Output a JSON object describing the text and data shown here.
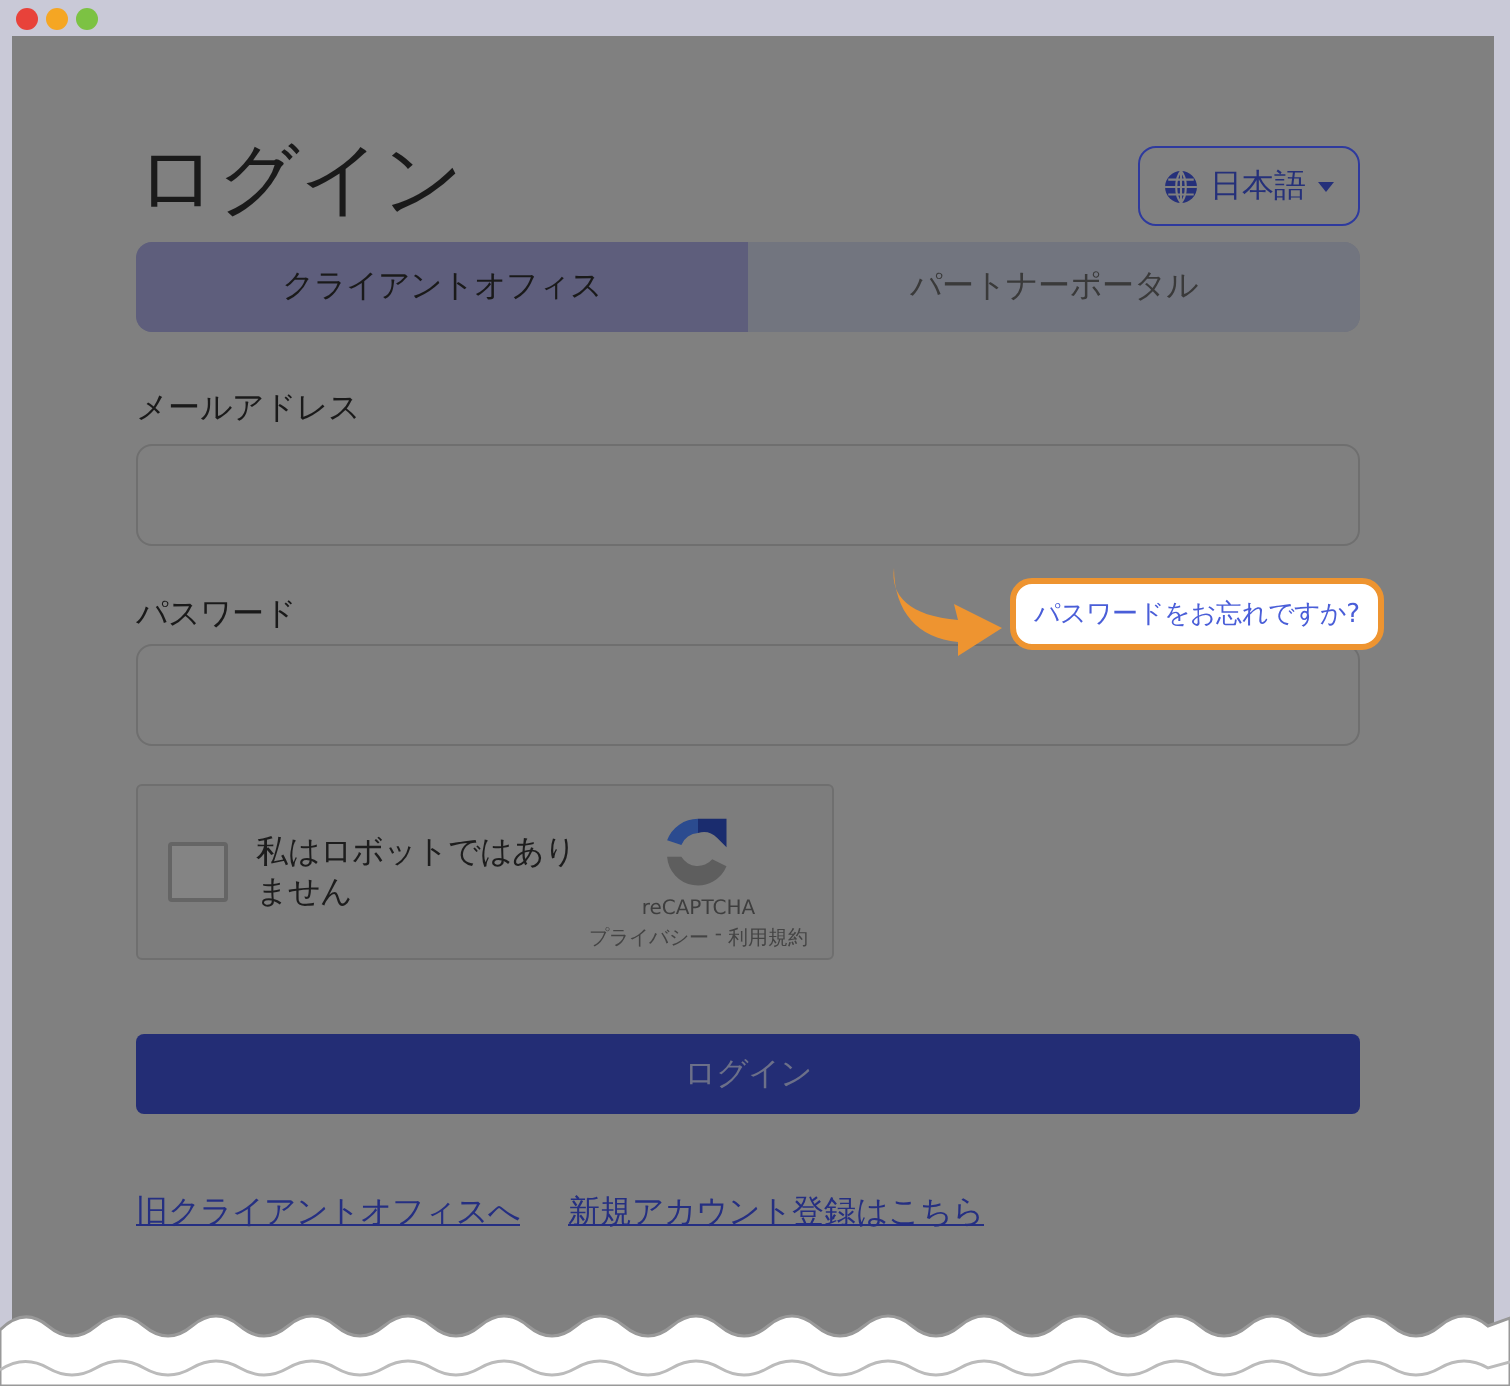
{
  "title": "ログイン",
  "language_button": {
    "label": "日本語"
  },
  "tabs": [
    {
      "label": "クライアントオフィス",
      "selected": true
    },
    {
      "label": "パートナーポータル",
      "selected": false
    }
  ],
  "email": {
    "label": "メールアドレス"
  },
  "password": {
    "label": "パスワード"
  },
  "forgot_link": {
    "label": "パスワードをお忘れですか?",
    "highlighted": true
  },
  "captcha": {
    "label": "私はロボットではありません",
    "checked": false,
    "brand": "reCAPTCHA",
    "privacy": "プライバシー",
    "separator": "-",
    "terms": "利用規約"
  },
  "submit": {
    "label": "ログイン"
  },
  "links": [
    "旧クライアントオフィスへ",
    "新規アカウント登録はこちら"
  ]
}
